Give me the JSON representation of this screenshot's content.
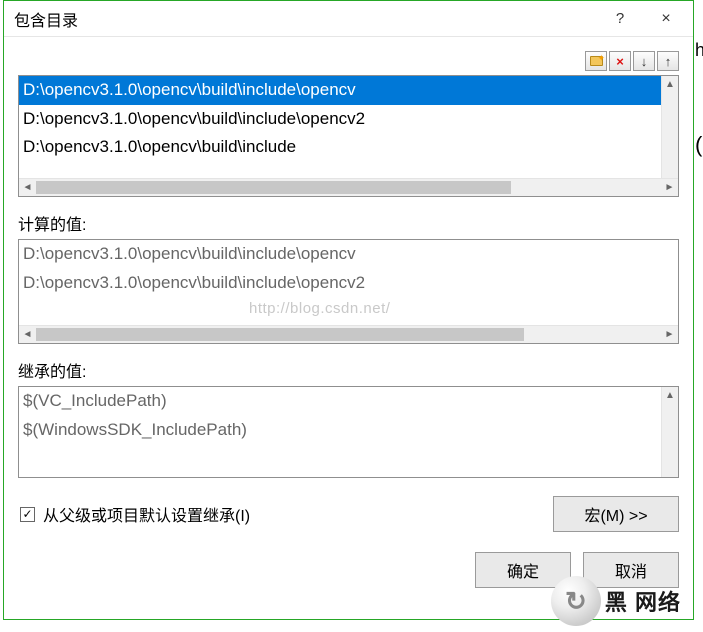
{
  "window": {
    "title": "包含目录",
    "help_tip": "?",
    "close_tip": "×"
  },
  "toolbar": {
    "new_line": "新建行",
    "delete_line": "×",
    "move_down": "↓",
    "move_up": "↑"
  },
  "edit_list": {
    "items": [
      "D:\\opencv3.1.0\\opencv\\build\\include\\opencv",
      "D:\\opencv3.1.0\\opencv\\build\\include\\opencv2",
      "D:\\opencv3.1.0\\opencv\\build\\include"
    ],
    "selected_index": 0
  },
  "computed": {
    "label": "计算的值:",
    "items": [
      "D:\\opencv3.1.0\\opencv\\build\\include\\opencv",
      "D:\\opencv3.1.0\\opencv\\build\\include\\opencv2"
    ]
  },
  "inherited": {
    "label": "继承的值:",
    "items": [
      "$(VC_IncludePath)",
      "$(WindowsSDK_IncludePath)"
    ]
  },
  "inherit_checkbox": {
    "checked": true,
    "label": "从父级或项目默认设置继承(I)"
  },
  "buttons": {
    "macros": "宏(M) >>",
    "ok": "确定",
    "cancel": "取消"
  },
  "watermark": "http://blog.csdn.net/",
  "overlay": {
    "brand": "黑  网络"
  }
}
